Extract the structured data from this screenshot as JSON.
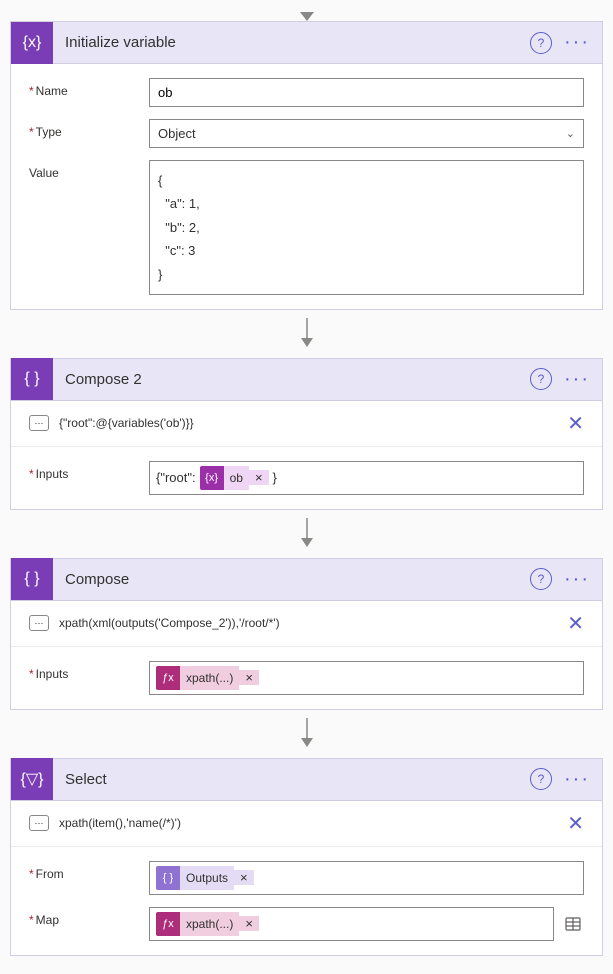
{
  "actions": {
    "init": {
      "title": "Initialize variable",
      "nameLabel": "Name",
      "nameValue": "ob",
      "typeLabel": "Type",
      "typeValue": "Object",
      "valueLabel": "Value",
      "valueContent": "{\n  \"a\": 1,\n  \"b\": 2,\n  \"c\": 3\n}"
    },
    "compose2": {
      "title": "Compose 2",
      "expression": "{\"root\":@{variables('ob')}}",
      "inputsLabel": "Inputs",
      "prefix": "{\"root\":",
      "suffix": "}",
      "token": "ob"
    },
    "compose": {
      "title": "Compose",
      "expression": "xpath(xml(outputs('Compose_2')),'/root/*')",
      "inputsLabel": "Inputs",
      "token": "xpath(...)"
    },
    "select": {
      "title": "Select",
      "expression": "xpath(item(),'name(/*)')",
      "fromLabel": "From",
      "fromToken": "Outputs",
      "mapLabel": "Map",
      "mapToken": "xpath(...)"
    }
  },
  "glyphs": {
    "fx": "ƒx",
    "var": "{x}",
    "braces": "{ }",
    "filter": "{▽}",
    "help": "?",
    "dots": "···",
    "close": "✕",
    "tokenX": "×",
    "speech": "⋯"
  }
}
